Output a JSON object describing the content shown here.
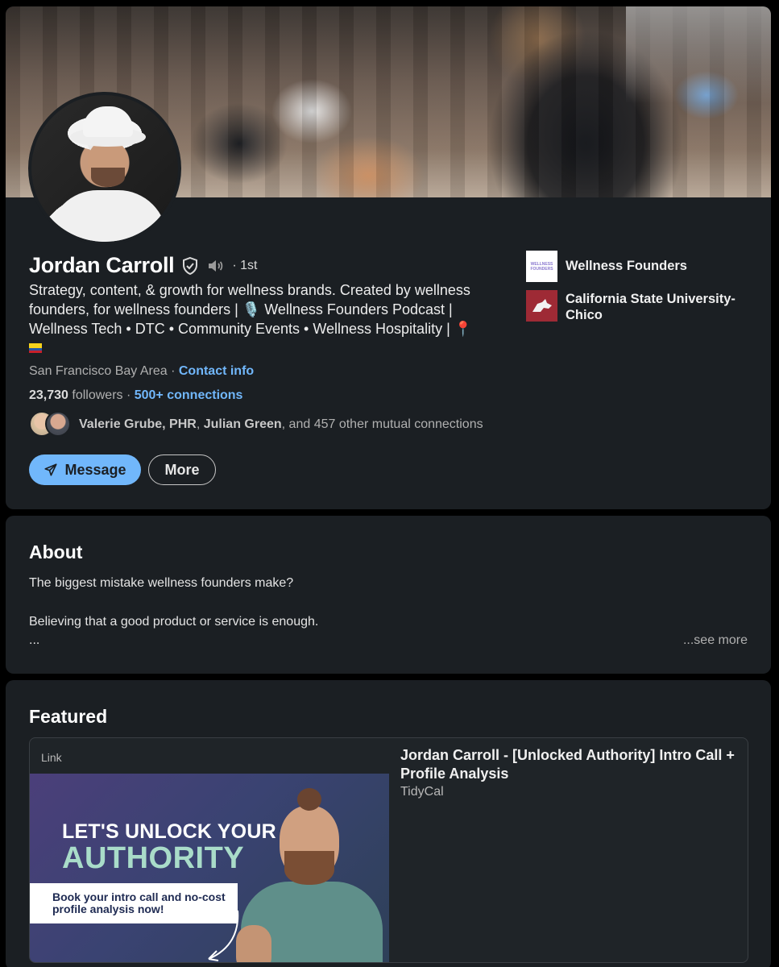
{
  "profile": {
    "name": "Jordan Carroll",
    "degree": "· 1st",
    "headline_lines": [
      "Strategy, content, & growth for wellness brands. Created by wellness",
      "founders, for wellness founders | 🎙️ Wellness Founders Podcast |",
      "Wellness Tech • DTC • Community Events • Wellness Hospitality | 📍"
    ],
    "location": "San Francisco Bay Area",
    "location_sep": " · ",
    "contact_info": "Contact info",
    "followers_count": "23,730",
    "followers_label": " followers",
    "connections_sep": " · ",
    "connections": "500+ connections",
    "mutual": {
      "name1": "Valerie Grube, PHR",
      "sep": ", ",
      "name2": "Julian Green",
      "rest": ", and 457 other mutual connections"
    },
    "buttons": {
      "message": "Message",
      "more": "More"
    },
    "orgs": [
      {
        "name": "Wellness Founders",
        "logo_text": "WELLNESS FOUNDERS"
      },
      {
        "name": "California State University-Chico"
      }
    ]
  },
  "about": {
    "title": "About",
    "line1": "The biggest mistake wellness founders make?",
    "line2": "Believing that a good product or service is enough.",
    "ellipsis": "...",
    "see_more": "...see more"
  },
  "featured": {
    "title": "Featured",
    "item": {
      "type": "Link",
      "title": "Jordan Carroll - [Unlocked Authority] Intro Call + Profile Analysis",
      "source": "TidyCal",
      "thumb": {
        "line1": "LET'S UNLOCK YOUR",
        "line2": "AUTHORITY",
        "box_text": "Book your intro call and no-cost profile analysis now!"
      }
    }
  },
  "colors": {
    "accent": "#71b7fb",
    "card_bg": "#1b1f23",
    "page_bg": "#000000"
  }
}
